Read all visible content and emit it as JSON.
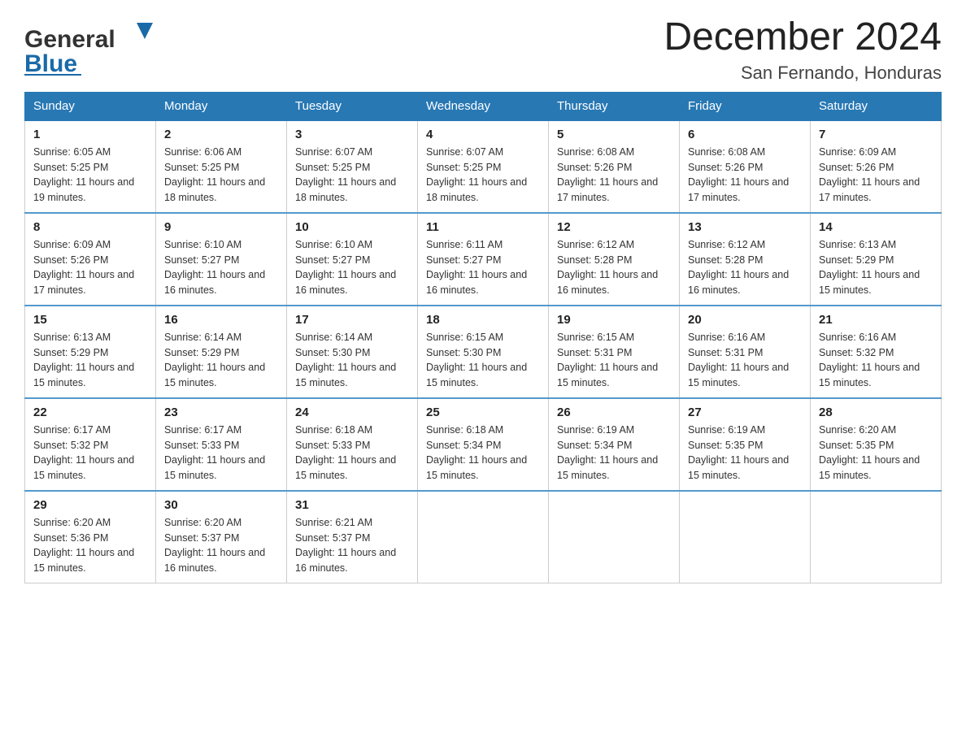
{
  "header": {
    "logo_general": "General",
    "logo_blue": "Blue",
    "month_title": "December 2024",
    "location": "San Fernando, Honduras"
  },
  "days_of_week": [
    "Sunday",
    "Monday",
    "Tuesday",
    "Wednesday",
    "Thursday",
    "Friday",
    "Saturday"
  ],
  "weeks": [
    [
      {
        "day": "1",
        "sunrise": "6:05 AM",
        "sunset": "5:25 PM",
        "daylight": "11 hours and 19 minutes."
      },
      {
        "day": "2",
        "sunrise": "6:06 AM",
        "sunset": "5:25 PM",
        "daylight": "11 hours and 18 minutes."
      },
      {
        "day": "3",
        "sunrise": "6:07 AM",
        "sunset": "5:25 PM",
        "daylight": "11 hours and 18 minutes."
      },
      {
        "day": "4",
        "sunrise": "6:07 AM",
        "sunset": "5:25 PM",
        "daylight": "11 hours and 18 minutes."
      },
      {
        "day": "5",
        "sunrise": "6:08 AM",
        "sunset": "5:26 PM",
        "daylight": "11 hours and 17 minutes."
      },
      {
        "day": "6",
        "sunrise": "6:08 AM",
        "sunset": "5:26 PM",
        "daylight": "11 hours and 17 minutes."
      },
      {
        "day": "7",
        "sunrise": "6:09 AM",
        "sunset": "5:26 PM",
        "daylight": "11 hours and 17 minutes."
      }
    ],
    [
      {
        "day": "8",
        "sunrise": "6:09 AM",
        "sunset": "5:26 PM",
        "daylight": "11 hours and 17 minutes."
      },
      {
        "day": "9",
        "sunrise": "6:10 AM",
        "sunset": "5:27 PM",
        "daylight": "11 hours and 16 minutes."
      },
      {
        "day": "10",
        "sunrise": "6:10 AM",
        "sunset": "5:27 PM",
        "daylight": "11 hours and 16 minutes."
      },
      {
        "day": "11",
        "sunrise": "6:11 AM",
        "sunset": "5:27 PM",
        "daylight": "11 hours and 16 minutes."
      },
      {
        "day": "12",
        "sunrise": "6:12 AM",
        "sunset": "5:28 PM",
        "daylight": "11 hours and 16 minutes."
      },
      {
        "day": "13",
        "sunrise": "6:12 AM",
        "sunset": "5:28 PM",
        "daylight": "11 hours and 16 minutes."
      },
      {
        "day": "14",
        "sunrise": "6:13 AM",
        "sunset": "5:29 PM",
        "daylight": "11 hours and 15 minutes."
      }
    ],
    [
      {
        "day": "15",
        "sunrise": "6:13 AM",
        "sunset": "5:29 PM",
        "daylight": "11 hours and 15 minutes."
      },
      {
        "day": "16",
        "sunrise": "6:14 AM",
        "sunset": "5:29 PM",
        "daylight": "11 hours and 15 minutes."
      },
      {
        "day": "17",
        "sunrise": "6:14 AM",
        "sunset": "5:30 PM",
        "daylight": "11 hours and 15 minutes."
      },
      {
        "day": "18",
        "sunrise": "6:15 AM",
        "sunset": "5:30 PM",
        "daylight": "11 hours and 15 minutes."
      },
      {
        "day": "19",
        "sunrise": "6:15 AM",
        "sunset": "5:31 PM",
        "daylight": "11 hours and 15 minutes."
      },
      {
        "day": "20",
        "sunrise": "6:16 AM",
        "sunset": "5:31 PM",
        "daylight": "11 hours and 15 minutes."
      },
      {
        "day": "21",
        "sunrise": "6:16 AM",
        "sunset": "5:32 PM",
        "daylight": "11 hours and 15 minutes."
      }
    ],
    [
      {
        "day": "22",
        "sunrise": "6:17 AM",
        "sunset": "5:32 PM",
        "daylight": "11 hours and 15 minutes."
      },
      {
        "day": "23",
        "sunrise": "6:17 AM",
        "sunset": "5:33 PM",
        "daylight": "11 hours and 15 minutes."
      },
      {
        "day": "24",
        "sunrise": "6:18 AM",
        "sunset": "5:33 PM",
        "daylight": "11 hours and 15 minutes."
      },
      {
        "day": "25",
        "sunrise": "6:18 AM",
        "sunset": "5:34 PM",
        "daylight": "11 hours and 15 minutes."
      },
      {
        "day": "26",
        "sunrise": "6:19 AM",
        "sunset": "5:34 PM",
        "daylight": "11 hours and 15 minutes."
      },
      {
        "day": "27",
        "sunrise": "6:19 AM",
        "sunset": "5:35 PM",
        "daylight": "11 hours and 15 minutes."
      },
      {
        "day": "28",
        "sunrise": "6:20 AM",
        "sunset": "5:35 PM",
        "daylight": "11 hours and 15 minutes."
      }
    ],
    [
      {
        "day": "29",
        "sunrise": "6:20 AM",
        "sunset": "5:36 PM",
        "daylight": "11 hours and 15 minutes."
      },
      {
        "day": "30",
        "sunrise": "6:20 AM",
        "sunset": "5:37 PM",
        "daylight": "11 hours and 16 minutes."
      },
      {
        "day": "31",
        "sunrise": "6:21 AM",
        "sunset": "5:37 PM",
        "daylight": "11 hours and 16 minutes."
      },
      null,
      null,
      null,
      null
    ]
  ]
}
